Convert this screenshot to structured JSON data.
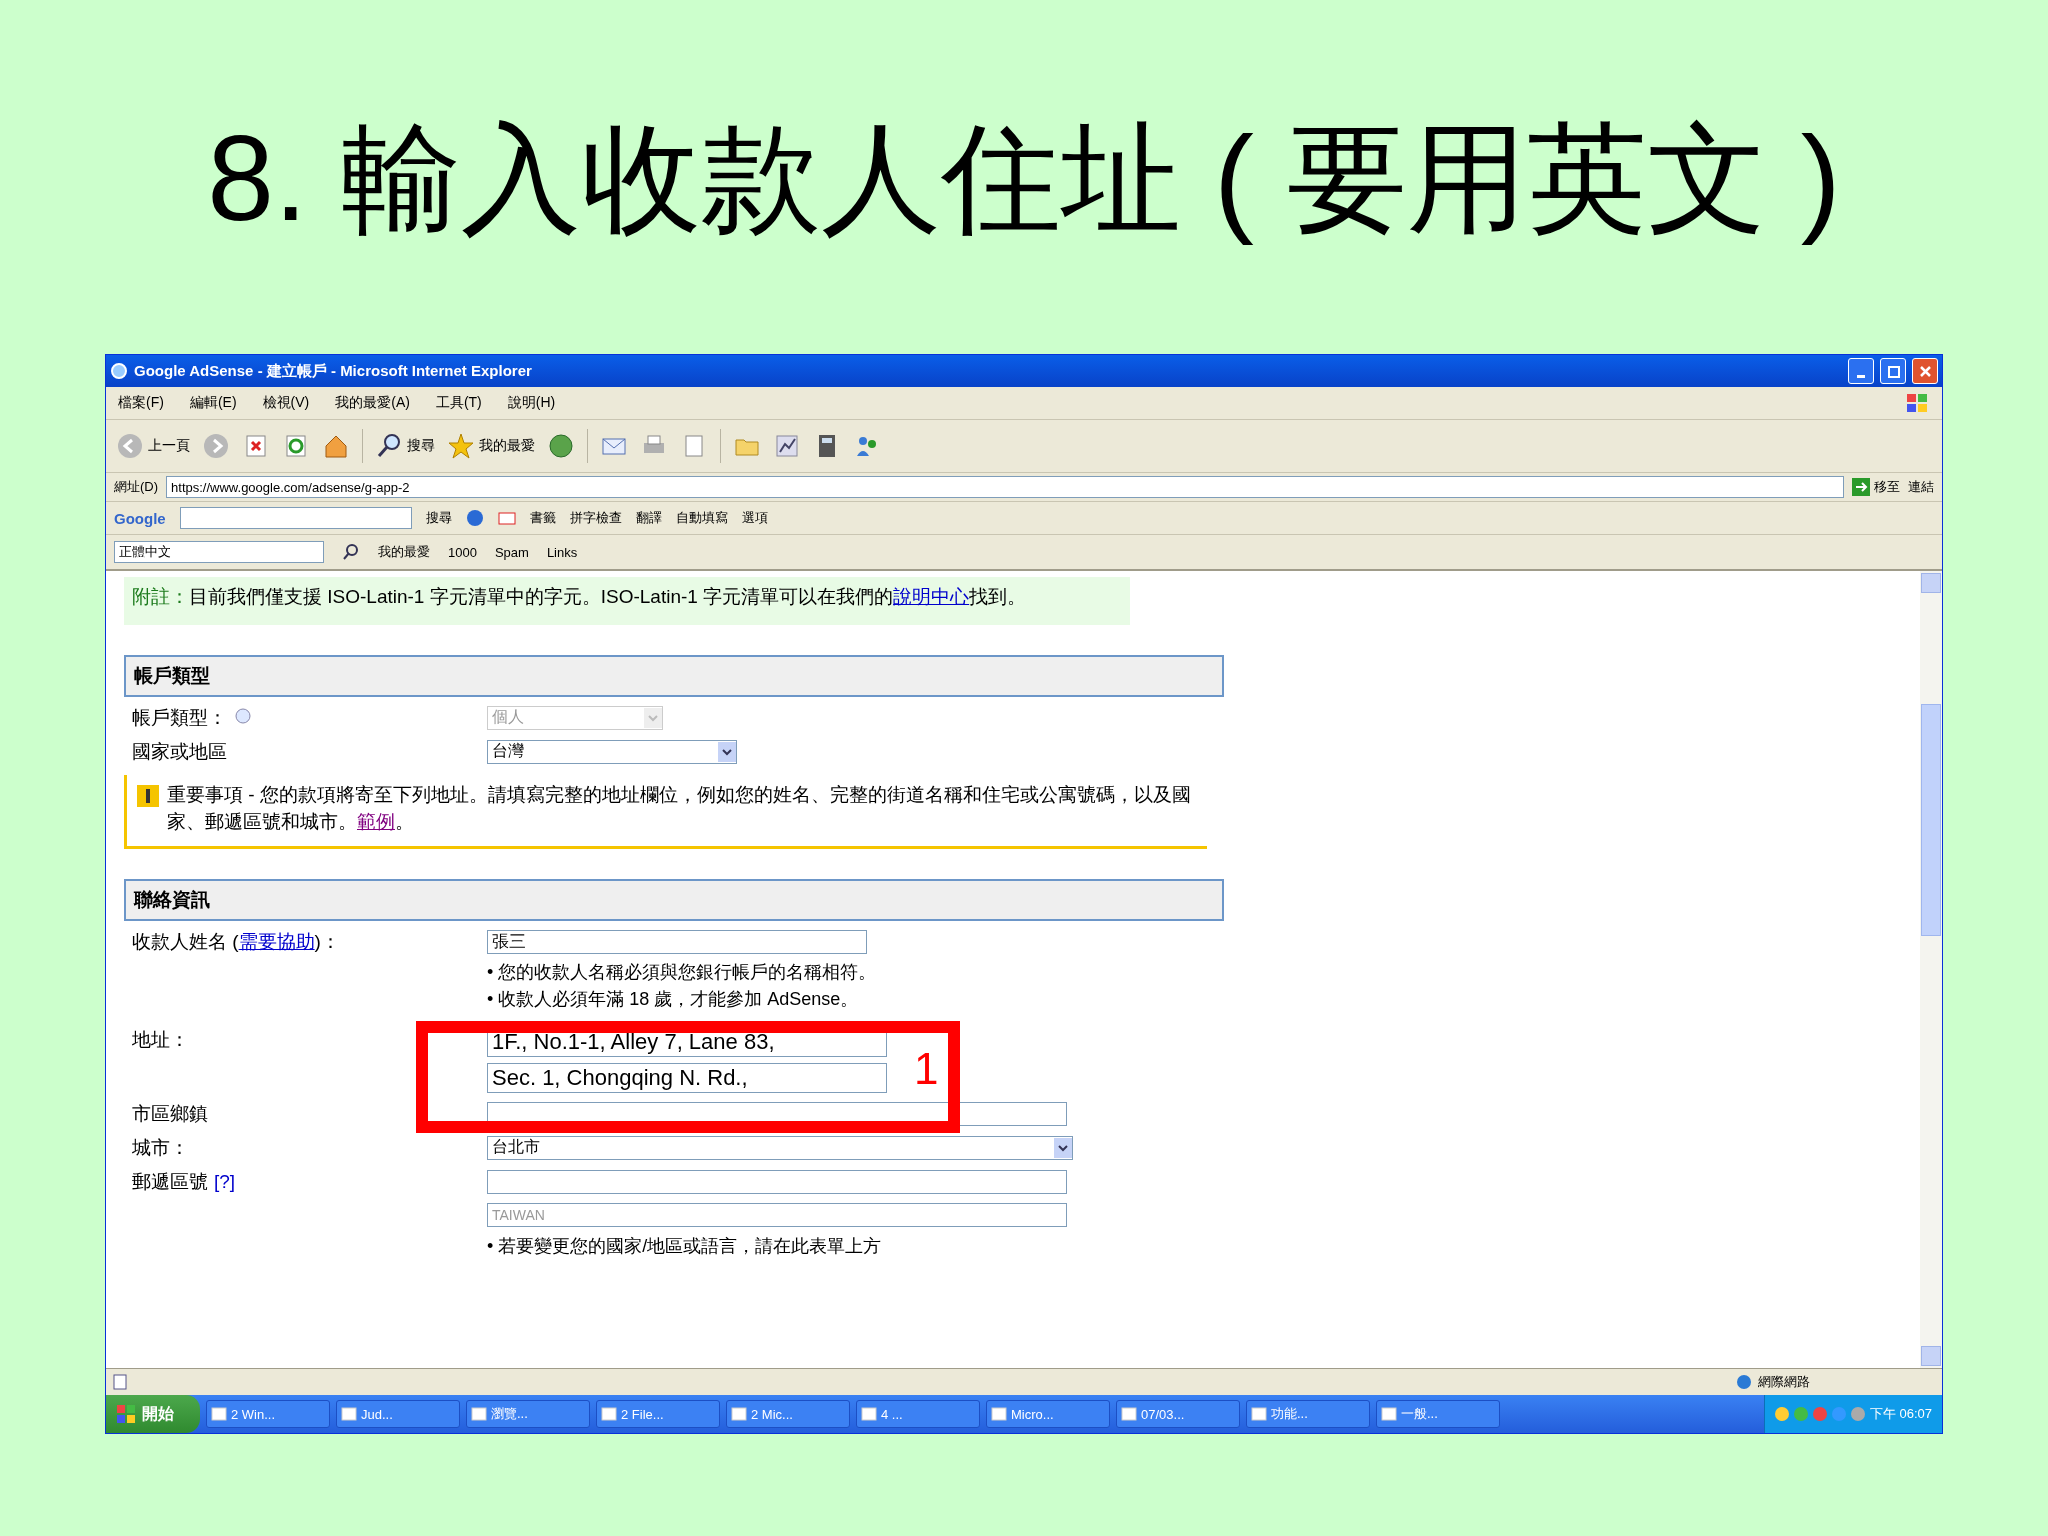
{
  "slide_title": "8. 輸入收款人住址 ( 要用英文 )",
  "window": {
    "title": "Google AdSense - 建立帳戶 - Microsoft Internet Explorer"
  },
  "menu": [
    "檔案(F)",
    "編輯(E)",
    "檢視(V)",
    "我的最愛(A)",
    "工具(T)",
    "說明(H)"
  ],
  "toolbar": [
    {
      "kind": "back",
      "label": "上一頁"
    },
    {
      "kind": "forward"
    },
    {
      "kind": "stop"
    },
    {
      "kind": "refresh"
    },
    {
      "kind": "home"
    },
    {
      "kind": "search",
      "label": "搜尋"
    },
    {
      "kind": "favorites",
      "label": "我的最愛"
    },
    {
      "kind": "history"
    },
    {
      "kind": "mail"
    },
    {
      "kind": "print"
    },
    {
      "kind": "edit"
    },
    {
      "kind": "folder"
    },
    {
      "kind": "chart"
    },
    {
      "kind": "calc"
    },
    {
      "kind": "people"
    }
  ],
  "address_bar": {
    "label": "網址(D)",
    "url": "https://www.google.com/adsense/g-app-2",
    "go": "移至",
    "links": "連結"
  },
  "google_bar": {
    "logo": "Google",
    "search_button": "搜尋",
    "items": [
      "書籤",
      "拼字檢查",
      "翻譯",
      "自動填寫",
      "選項"
    ]
  },
  "links_bar": {
    "field": "正體中文",
    "items": [
      "我的最愛",
      "1000",
      "Spam",
      "Links"
    ]
  },
  "note": {
    "label": "附註：",
    "text": "目前我們僅支援 ISO-Latin-1 字元清單中的字元。ISO-Latin-1 字元清單可以在我們的",
    "link": "說明中心",
    "after": "找到。"
  },
  "account": {
    "title": "帳戶類型",
    "type_label": "帳戶類型：",
    "type_value": "個人",
    "country_label": "國家或地區",
    "country_value": "台灣"
  },
  "warning": {
    "text": "重要事項 - 您的款項將寄至下列地址。請填寫完整的地址欄位，例如您的姓名、完整的街道名稱和住宅或公寓號碼，以及國家、郵遞區號和城市。",
    "link": "範例",
    "after": "。"
  },
  "contact": {
    "title": "聯絡資訊",
    "payee_before": "收款人姓名 (",
    "payee_link": "需要協助",
    "payee_after": ")：",
    "payee_value": "張三",
    "payee_notes": [
      "• 您的收款人名稱必須與您銀行帳戶的名稱相符。",
      "• 收款人必須年滿 18 歲，才能參加 AdSense。"
    ],
    "address_label": "地址：",
    "address_lines": [
      "1F., No.1-1, Alley 7, Lane 83,",
      "Sec. 1, Chongqing N. Rd.,"
    ],
    "district_label": "市區鄉鎮",
    "city_label": "城市：",
    "city_value": "台北市",
    "zip_label": "郵遞區號",
    "zip_help": "[?]",
    "country_value": "TAIWAN",
    "country_note": "• 若要變更您的國家/地區或語言，請在此表單上方"
  },
  "annotation": {
    "label": "1"
  },
  "status_bar": {
    "zone": "網際網路"
  },
  "taskbar": {
    "start": "開始",
    "tasks": [
      "2 Win...",
      "Jud...",
      "瀏覽...",
      "2 File...",
      "2 Mic...",
      "4 ...",
      "Micro...",
      "07/03...",
      "功能...",
      "一般..."
    ],
    "clock": "下午 06:07"
  }
}
